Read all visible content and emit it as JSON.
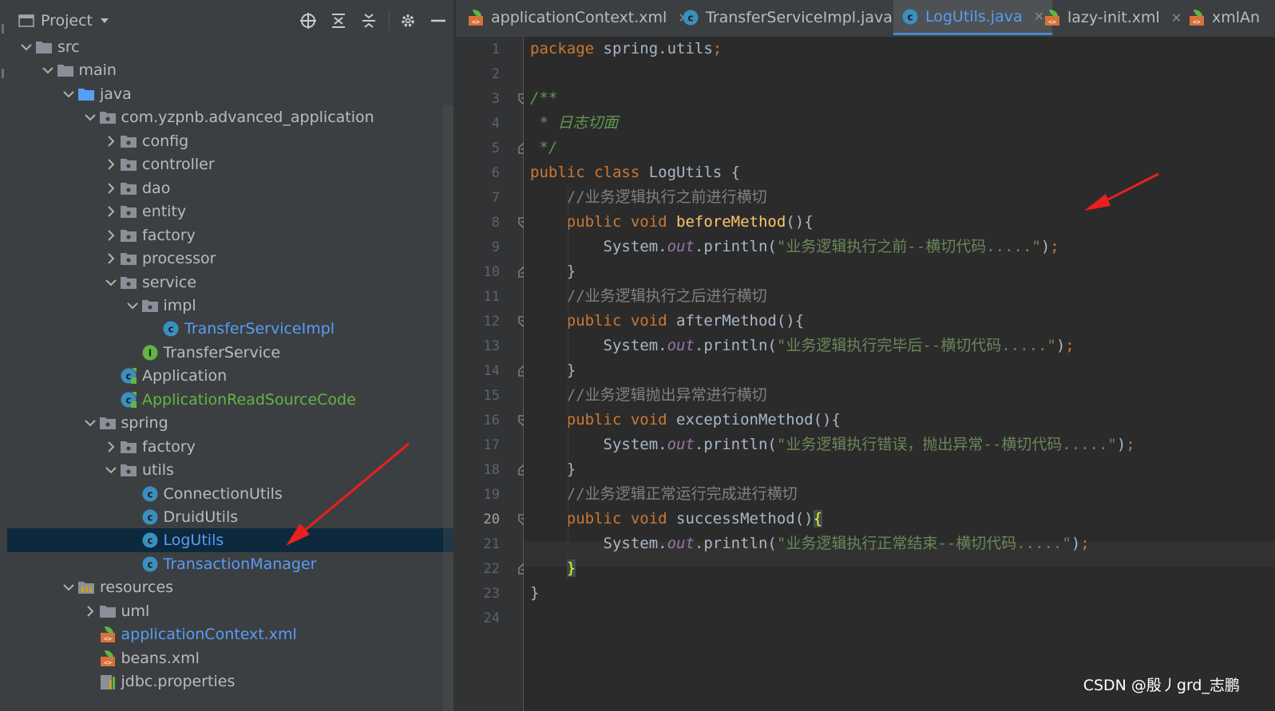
{
  "project_panel": {
    "title": "Project",
    "tree": [
      {
        "label": "src",
        "depth": 2,
        "expanded": true,
        "type": "folder"
      },
      {
        "label": "main",
        "depth": 3,
        "expanded": true,
        "type": "folder"
      },
      {
        "label": "java",
        "depth": 4,
        "expanded": true,
        "type": "source-folder"
      },
      {
        "label": "com.yzpnb.advanced_application",
        "depth": 5,
        "expanded": true,
        "type": "package"
      },
      {
        "label": "config",
        "depth": 6,
        "expanded": false,
        "type": "package"
      },
      {
        "label": "controller",
        "depth": 6,
        "expanded": false,
        "type": "package"
      },
      {
        "label": "dao",
        "depth": 6,
        "expanded": false,
        "type": "package"
      },
      {
        "label": "entity",
        "depth": 6,
        "expanded": false,
        "type": "package"
      },
      {
        "label": "factory",
        "depth": 6,
        "expanded": false,
        "type": "package"
      },
      {
        "label": "processor",
        "depth": 6,
        "expanded": false,
        "type": "package"
      },
      {
        "label": "service",
        "depth": 6,
        "expanded": true,
        "type": "package"
      },
      {
        "label": "impl",
        "depth": 7,
        "expanded": true,
        "type": "package"
      },
      {
        "label": "TransferServiceImpl",
        "depth": 8,
        "type": "class",
        "color": "blue"
      },
      {
        "label": "TransferService",
        "depth": 7,
        "type": "interface"
      },
      {
        "label": "Application",
        "depth": 6,
        "type": "spring-class"
      },
      {
        "label": "ApplicationReadSourceCode",
        "depth": 6,
        "type": "spring-class",
        "color": "green"
      },
      {
        "label": "spring",
        "depth": 5,
        "expanded": true,
        "type": "package"
      },
      {
        "label": "factory",
        "depth": 6,
        "expanded": false,
        "type": "package"
      },
      {
        "label": "utils",
        "depth": 6,
        "expanded": true,
        "type": "package"
      },
      {
        "label": "ConnectionUtils",
        "depth": 7,
        "type": "class"
      },
      {
        "label": "DruidUtils",
        "depth": 7,
        "type": "class"
      },
      {
        "label": "LogUtils",
        "depth": 7,
        "type": "class",
        "color": "blue",
        "selected": true
      },
      {
        "label": "TransactionManager",
        "depth": 7,
        "type": "class",
        "color": "blue"
      },
      {
        "label": "resources",
        "depth": 4,
        "expanded": true,
        "type": "resources-folder"
      },
      {
        "label": "uml",
        "depth": 5,
        "expanded": false,
        "type": "folder"
      },
      {
        "label": "applicationContext.xml",
        "depth": 5,
        "type": "xml",
        "color": "blue"
      },
      {
        "label": "beans.xml",
        "depth": 5,
        "type": "xml"
      },
      {
        "label": "jdbc.properties",
        "depth": 5,
        "type": "properties"
      }
    ]
  },
  "tabs": [
    {
      "label": "applicationContext.xml",
      "icon": "xml-icon",
      "active": false
    },
    {
      "label": "TransferServiceImpl.java",
      "icon": "class-icon",
      "active": false
    },
    {
      "label": "LogUtils.java",
      "icon": "class-icon",
      "active": true
    },
    {
      "label": "lazy-init.xml",
      "icon": "xml-icon",
      "active": false
    },
    {
      "label": "xmlAn",
      "icon": "xml-icon",
      "active": false
    }
  ],
  "editor": {
    "current_line": 20,
    "lines": [
      {
        "n": "1",
        "tokens": [
          [
            "kw",
            "package "
          ],
          [
            "",
            "spring.utils"
          ],
          [
            "kw",
            ";"
          ]
        ]
      },
      {
        "n": "2",
        "tokens": []
      },
      {
        "n": "3",
        "tokens": [
          [
            "dc",
            "/**"
          ]
        ]
      },
      {
        "n": "4",
        "tokens": [
          [
            "dc",
            " * 日志切面"
          ]
        ]
      },
      {
        "n": "5",
        "tokens": [
          [
            "dc",
            " */"
          ]
        ]
      },
      {
        "n": "6",
        "tokens": [
          [
            "kw",
            "public class "
          ],
          [
            "",
            "LogUtils {"
          ]
        ]
      },
      {
        "n": "7",
        "tokens": [
          [
            "cm",
            "    //业务逻辑执行之前进行横切"
          ]
        ]
      },
      {
        "n": "8",
        "tokens": [
          [
            "kw",
            "    public void "
          ],
          [
            "fn",
            "beforeMethod"
          ],
          [
            "",
            "(){"
          ]
        ]
      },
      {
        "n": "9",
        "tokens": [
          [
            "",
            "        System."
          ],
          [
            "fd",
            "out"
          ],
          [
            "",
            ".println("
          ],
          [
            "st",
            "\"业务逻辑执行之前--横切代码.....\""
          ],
          [
            "",
            ")"
          ],
          [
            "kw",
            ";"
          ]
        ]
      },
      {
        "n": "10",
        "tokens": [
          [
            "",
            "    }"
          ]
        ]
      },
      {
        "n": "11",
        "tokens": [
          [
            "cm",
            "    //业务逻辑执行之后进行横切"
          ]
        ]
      },
      {
        "n": "12",
        "tokens": [
          [
            "kw",
            "    public void "
          ],
          [
            "",
            "afterMethod(){"
          ]
        ]
      },
      {
        "n": "13",
        "tokens": [
          [
            "",
            "        System."
          ],
          [
            "fd",
            "out"
          ],
          [
            "",
            ".println("
          ],
          [
            "st",
            "\"业务逻辑执行完毕后--横切代码.....\""
          ],
          [
            "",
            ")"
          ],
          [
            "kw",
            ";"
          ]
        ]
      },
      {
        "n": "14",
        "tokens": [
          [
            "",
            "    }"
          ]
        ]
      },
      {
        "n": "15",
        "tokens": [
          [
            "cm",
            "    //业务逻辑抛出异常进行横切"
          ]
        ]
      },
      {
        "n": "16",
        "tokens": [
          [
            "kw",
            "    public void "
          ],
          [
            "",
            "exceptionMethod(){"
          ]
        ]
      },
      {
        "n": "17",
        "tokens": [
          [
            "",
            "        System."
          ],
          [
            "fd",
            "out"
          ],
          [
            "",
            ".println("
          ],
          [
            "st",
            "\"业务逻辑执行错误，抛出异常--横切代码.....\""
          ],
          [
            "",
            ")"
          ],
          [
            "kw",
            ";"
          ]
        ]
      },
      {
        "n": "18",
        "tokens": [
          [
            "",
            "    }"
          ]
        ]
      },
      {
        "n": "19",
        "tokens": [
          [
            "cm",
            "    //业务逻辑正常运行完成进行横切"
          ]
        ]
      },
      {
        "n": "20",
        "tokens": [
          [
            "kw",
            "    public void "
          ],
          [
            "",
            "successMethod()"
          ],
          [
            "bh",
            "{"
          ]
        ]
      },
      {
        "n": "21",
        "tokens": [
          [
            "",
            "        System."
          ],
          [
            "fd",
            "out"
          ],
          [
            "",
            ".println("
          ],
          [
            "st",
            "\"业务逻辑执行正常结束--横切代码.....\""
          ],
          [
            "",
            ")"
          ],
          [
            "kw",
            ";"
          ]
        ]
      },
      {
        "n": "22",
        "tokens": [
          [
            "",
            "    "
          ],
          [
            "bh",
            "}"
          ]
        ]
      },
      {
        "n": "23",
        "tokens": [
          [
            "",
            "}"
          ]
        ]
      },
      {
        "n": "24",
        "tokens": []
      }
    ]
  },
  "watermark": "CSDN @殷丿grd_志鹏",
  "colors": {
    "arrow": "#e8201f",
    "selection": "#0d293e",
    "accent": "#4a88c7"
  }
}
